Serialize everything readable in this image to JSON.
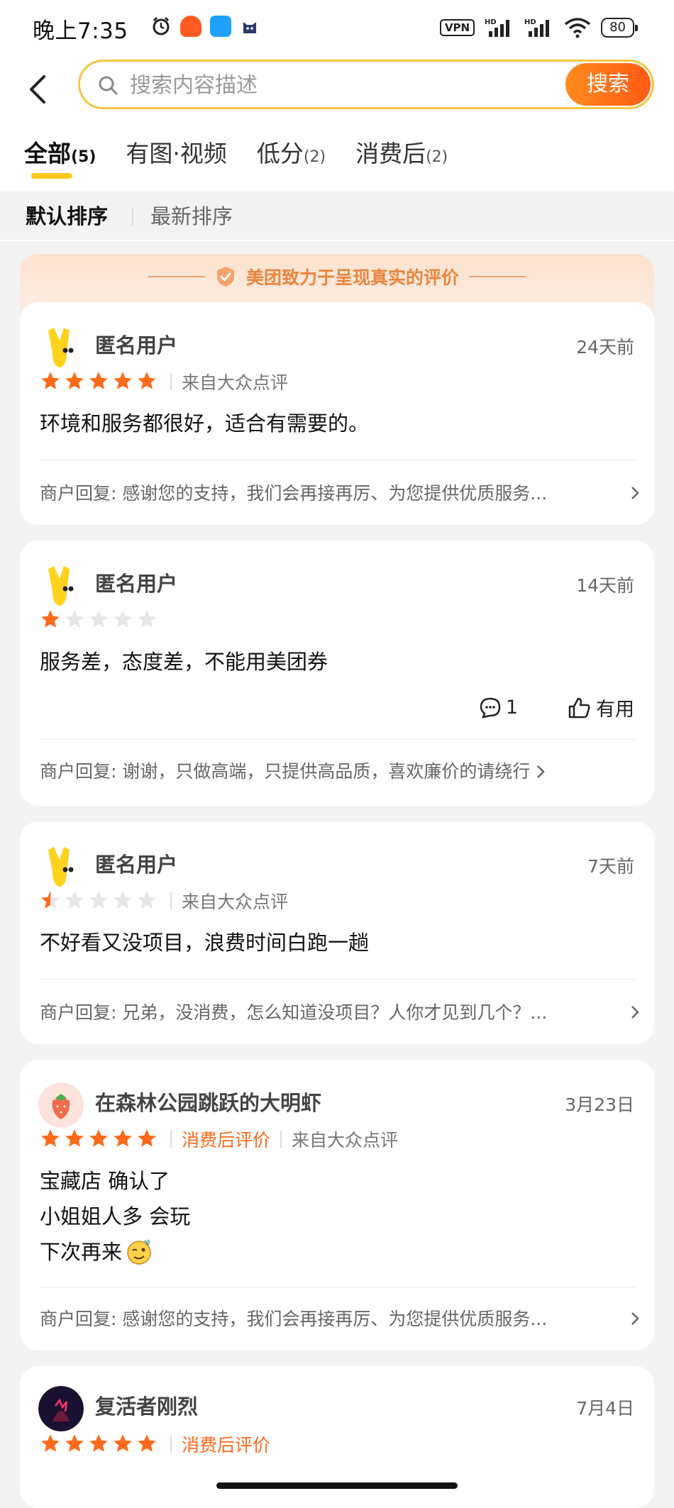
{
  "status": {
    "time": "晚上7:35",
    "vpn": "VPN",
    "battery": "80"
  },
  "search": {
    "placeholder": "搜索内容描述",
    "button": "搜索"
  },
  "tabs": [
    {
      "label": "全部",
      "count": "(5)"
    },
    {
      "label": "有图·视频",
      "count": ""
    },
    {
      "label": "低分",
      "count": "(2)"
    },
    {
      "label": "消费后",
      "count": "(2)"
    }
  ],
  "sort": {
    "default": "默认排序",
    "latest": "最新排序"
  },
  "banner": "美团致力于呈现真实的评价",
  "reviews": [
    {
      "user": "匿名用户",
      "time": "24天前",
      "rating": 5,
      "source": "来自大众点评",
      "text": [
        "环境和服务都很好，适合有需要的。"
      ],
      "reply": "商户回复: 感谢您的支持，我们会再接再厉、为您提供优质服务..."
    },
    {
      "user": "匿名用户",
      "time": "14天前",
      "rating": 1,
      "text": [
        "服务差，态度差，不能用美团券"
      ],
      "comment_count": "1",
      "useful_label": "有用",
      "reply": "商户回复: 谢谢，只做高端，只提供高品质，喜欢廉价的请绕行"
    },
    {
      "user": "匿名用户",
      "time": "7天前",
      "rating": 0.5,
      "source": "来自大众点评",
      "text": [
        "不好看又没项目，浪费时间白跑一趟"
      ],
      "reply": "商户回复: 兄弟，没消费，怎么知道没项目？人你才见到几个？..."
    },
    {
      "user": "在森林公园跳跃的大明虾",
      "time": "3月23日",
      "rating": 5,
      "tag": "消费后评价",
      "source": "来自大众点评",
      "text": [
        "宝藏店 确认了",
        "小姐姐人多 会玩",
        "下次再来"
      ],
      "reply": "商户回复: 感谢您的支持，我们会再接再厉、为您提供优质服务..."
    },
    {
      "user": "复活者刚烈",
      "time": "7月4日",
      "rating": 5,
      "tag": "消费后评价"
    }
  ],
  "colors": {
    "accent": "#ff6a1a",
    "star_on": "#ff6a1a",
    "star_off": "#e6e6e6",
    "search_border": "#f6c744",
    "tab_indicator": "#ffc81e"
  }
}
